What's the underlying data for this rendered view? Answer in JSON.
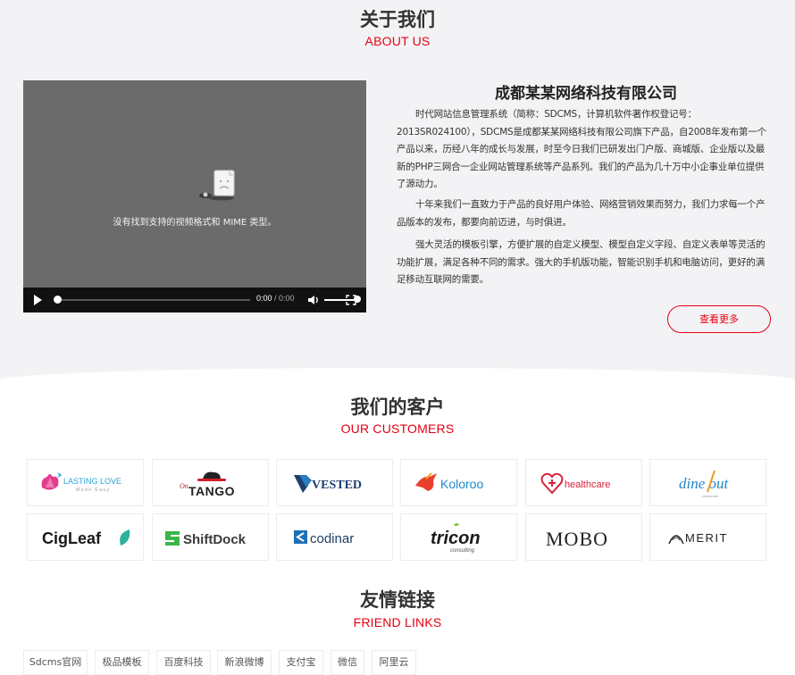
{
  "about": {
    "title": "关于我们",
    "subtitle": "ABOUT US",
    "company": "成都某某网络科技有限公司",
    "paragraphs": [
      "时代网站信息管理系统（简称：SDCMS，计算机软件著作权登记号：2013SR024100），SDCMS是成都某某网络科技有限公司旗下产品，自2008年发布第一个产品以来，历经八年的成长与发展，时至今日我们已研发出门户版、商城版、企业版以及最新的PHP三网合一企业网站管理系统等产品系列。我们的产品为几十万中小企事业单位提供了源动力。",
      "十年来我们一直致力于产品的良好用户体验、网络营销效果而努力，我们力求每一个产品版本的发布，都要向前迈进，与时俱进。",
      "强大灵活的模板引擎，方便扩展的自定义模型、模型自定义字段、自定义表单等灵活的功能扩展，满足各种不同的需求。强大的手机版功能，智能识别手机和电脑访问，更好的满足移动互联网的需要。"
    ],
    "more_label": "查看更多",
    "video": {
      "message": "没有找到支持的视频格式和 MIME 类型。",
      "time_current": "0:00",
      "time_sep": " / ",
      "time_total": "0:00"
    }
  },
  "customers": {
    "title": "我们的客户",
    "subtitle": "OUR CUSTOMERS",
    "logos": [
      "LASTING LOVE",
      "TANGO",
      "VESTED",
      "Koloroo",
      "healthcare",
      "dine out",
      "CigLeaf",
      "ShiftDock",
      "codinar",
      "tricon",
      "MOBO",
      "MERIT"
    ],
    "logo_extra": {
      "lasting_love_tag": "Made Easy",
      "tango_prefix": "On",
      "dineout_tag": "restaurant",
      "tricon_tag": "consulting"
    }
  },
  "friends": {
    "title": "友情链接",
    "subtitle": "FRIEND LINKS",
    "links": [
      "Sdcms官网",
      "极品模板",
      "百度科技",
      "新浪微博",
      "支付宝",
      "微信",
      "阿里云"
    ]
  },
  "colors": {
    "accent": "#e60012",
    "section_bg": "#f3f3f5"
  }
}
